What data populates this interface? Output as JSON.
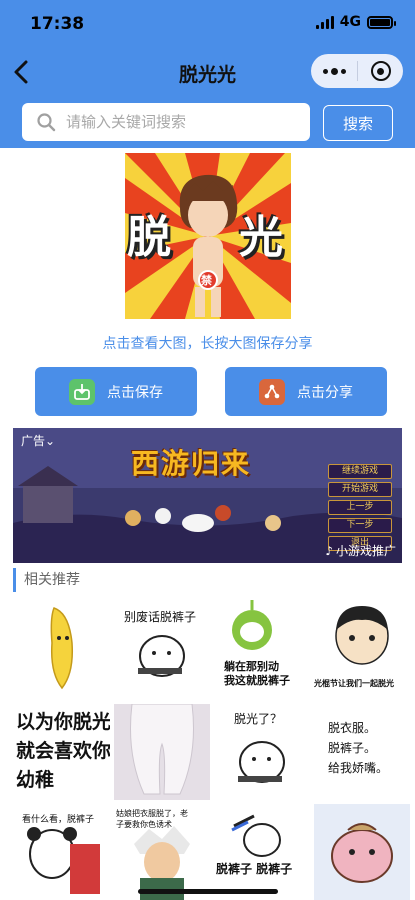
{
  "status": {
    "time": "17:38",
    "network": "4G"
  },
  "nav": {
    "title": "脱光光"
  },
  "search": {
    "placeholder": "请输入关键词搜索",
    "button": "搜索"
  },
  "hint": "点击查看大图，长按大图保存分享",
  "actions": {
    "save": "点击保存",
    "share": "点击分享"
  },
  "main_image": {
    "left_char": "脱",
    "right_char": "光",
    "badge": "禁"
  },
  "ad": {
    "tag": "广告",
    "title": "西游归来",
    "menu": [
      "继续游戏",
      "开始游戏",
      "上一步",
      "下一步",
      "退出"
    ],
    "source": "小游戏推广"
  },
  "section_title": "相关推荐",
  "grid": [
    {
      "text": ""
    },
    {
      "text": "别废话脱裤子"
    },
    {
      "text": "躺在那别动\n我这就脱裤子"
    },
    {
      "text": "光棍节让我们一起脱光"
    },
    {
      "text": "以为你脱光\n就会喜欢你\n幼稚"
    },
    {
      "text": ""
    },
    {
      "text": "脱光了？"
    },
    {
      "text": "脱衣服。\n脱裤子。\n给我娇嘴。"
    },
    {
      "text": "看什么看，脱裤子"
    },
    {
      "text": "姑娘把衣服脱了，老\n子要救你色诱术"
    },
    {
      "text": "脱裤子 脱裤子"
    },
    {
      "text": ""
    }
  ],
  "colors": {
    "primary": "#4a8ee8",
    "hint_text": "#4a8ee8",
    "ad_gold": "#f7b821"
  }
}
